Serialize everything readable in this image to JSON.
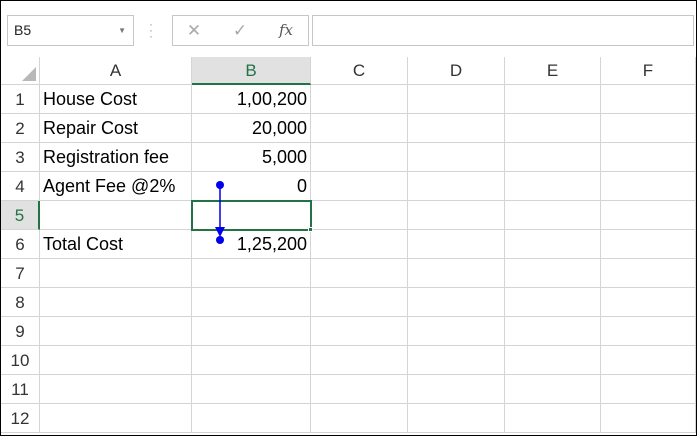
{
  "name_box": {
    "value": "B5",
    "dropdown_icon": "chevron-down-icon"
  },
  "formula_bar": {
    "cancel_icon": "x-icon",
    "enter_icon": "check-icon",
    "fx_label": "fx",
    "formula_value": ""
  },
  "columns": [
    "A",
    "B",
    "C",
    "D",
    "E",
    "F"
  ],
  "rows": [
    "1",
    "2",
    "3",
    "4",
    "5",
    "6",
    "7",
    "8",
    "9",
    "10",
    "11",
    "12"
  ],
  "cells": {
    "A1": "House Cost",
    "B1": "1,00,200",
    "A2": "Repair Cost",
    "B2": "20,000",
    "A3": "Registration fee",
    "B3": "5,000",
    "A4": "Agent Fee @2%",
    "B4": "0",
    "A5": "",
    "B5": "",
    "A6": "Total Cost",
    "B6": "1,25,200"
  },
  "selection": {
    "active_cell": "B5",
    "active_column": "B",
    "active_row": "5"
  },
  "colors": {
    "accent": "#217346",
    "trace_arrow": "#0000ee"
  }
}
